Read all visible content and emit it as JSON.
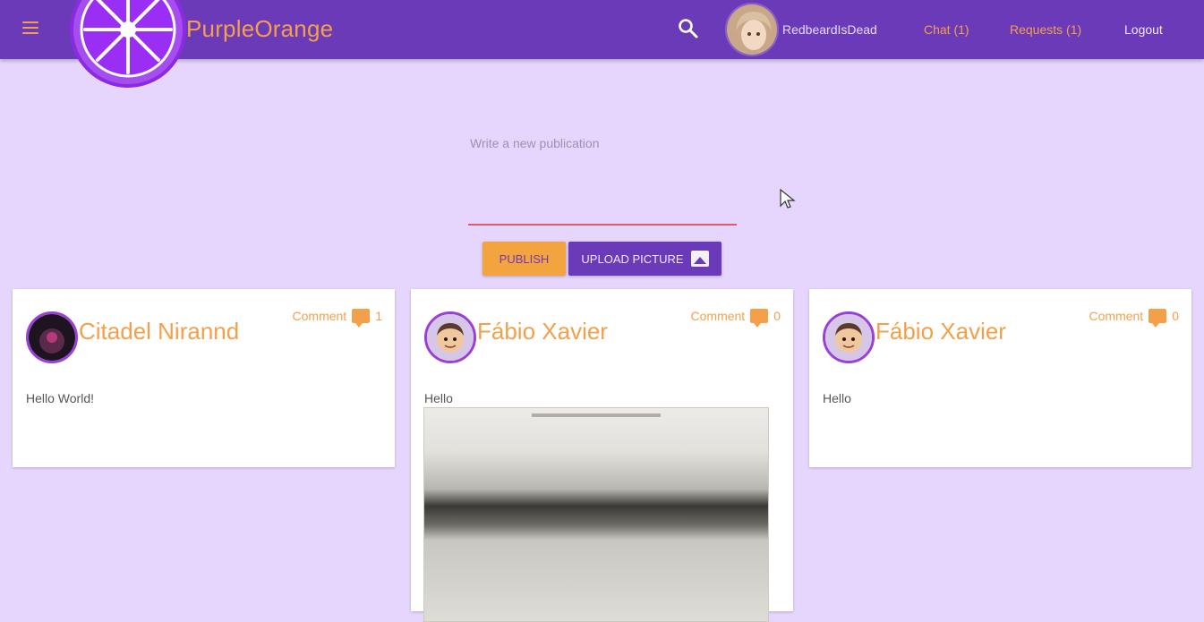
{
  "app": {
    "brand": "PurpleOrange",
    "username": "RedbeardIsDead",
    "nav": {
      "chat_label": "Chat (1)",
      "requests_label": "Requests (1)",
      "logout_label": "Logout"
    }
  },
  "composer": {
    "placeholder": "Write a new publication",
    "publish_label": "PUBLISH",
    "upload_label": "UPLOAD PICTURE"
  },
  "posts": [
    {
      "author": "Citadel Nirannd",
      "comment_label": "Comment",
      "comment_count": "1",
      "text": "Hello World!"
    },
    {
      "author": "Fábio Xavier",
      "comment_label": "Comment",
      "comment_count": "0",
      "text": "Hello"
    },
    {
      "author": "Fábio Xavier",
      "comment_label": "Comment",
      "comment_count": "0",
      "text": "Hello"
    }
  ],
  "colors": {
    "background": "#e6d6fe",
    "navbar": "#6a3ab8",
    "accent_orange": "#f4a04a",
    "logo_purple": "#a64df0"
  },
  "icons": {
    "menu": "hamburger-icon",
    "search": "search-icon",
    "comment": "comment-icon",
    "upload": "image-icon"
  }
}
